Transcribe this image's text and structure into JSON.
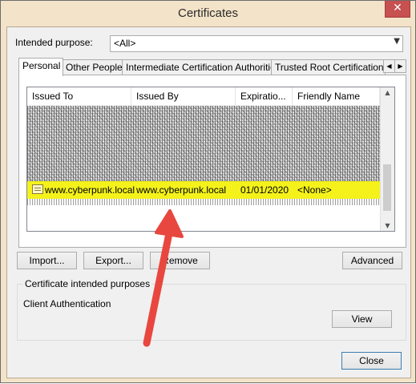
{
  "window": {
    "title": "Certificates",
    "close_symbol": "✕"
  },
  "purpose": {
    "label": "Intended purpose:",
    "value": "<All>"
  },
  "tabs": [
    {
      "label": "Personal",
      "active": true
    },
    {
      "label": "Other People"
    },
    {
      "label": "Intermediate Certification Authorities"
    },
    {
      "label": "Trusted Root Certification"
    }
  ],
  "tab_scroll": {
    "left": "◀",
    "right": "▶"
  },
  "columns": [
    "Issued To",
    "Issued By",
    "Expiratio...",
    "Friendly Name"
  ],
  "selected_row": {
    "issued_to": "www.cyberpunk.local",
    "issued_by": "www.cyberpunk.local",
    "expiration": "01/01/2020",
    "friendly_name": "<None>"
  },
  "buttons": {
    "import": "Import...",
    "export": "Export...",
    "remove": "Remove",
    "advanced": "Advanced",
    "view": "View",
    "close": "Close"
  },
  "purposes_group": {
    "title": "Certificate intended purposes",
    "value": "Client Authentication"
  },
  "colors": {
    "highlight": "#f4f21a",
    "arrow": "#e8473f"
  },
  "annotation": {
    "arrow_icon": "arrow-annotation-icon"
  }
}
